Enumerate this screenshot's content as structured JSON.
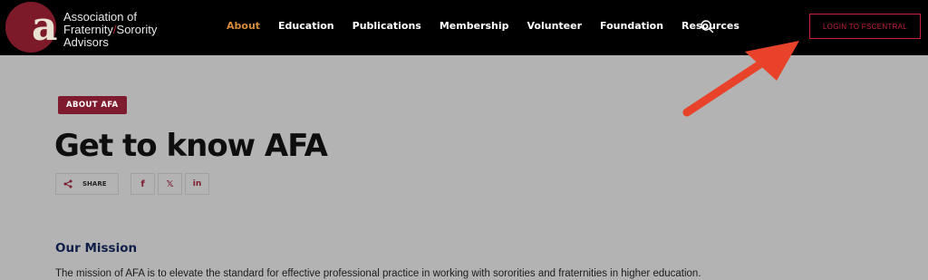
{
  "header": {
    "logo": {
      "letter": "a",
      "text_line1": "Association of",
      "text_line2a": "Fraternity",
      "text_slash": "/",
      "text_line2b": "Sorority",
      "text_line3": "Advisors"
    },
    "nav": [
      {
        "label": "About",
        "active": true
      },
      {
        "label": "Education",
        "active": false
      },
      {
        "label": "Publications",
        "active": false
      },
      {
        "label": "Membership",
        "active": false
      },
      {
        "label": "Volunteer",
        "active": false
      },
      {
        "label": "Foundation",
        "active": false
      },
      {
        "label": "Resources",
        "active": false
      }
    ],
    "search_icon": "search-icon",
    "login_label": "LOGIN TO FSCENTRAL"
  },
  "main": {
    "badge": "ABOUT AFA",
    "title": "Get to know AFA",
    "share_label": "SHARE",
    "social": [
      {
        "icon": "facebook-icon",
        "glyph": "f"
      },
      {
        "icon": "x-icon",
        "glyph": "𝕏"
      },
      {
        "icon": "linkedin-icon",
        "glyph": "in"
      }
    ],
    "mission_title": "Our Mission",
    "mission_text": "The mission of AFA is to elevate the standard for effective professional practice in working with sororities and fraternities in higher education."
  },
  "colors": {
    "brand_red": "#7f1b2e",
    "nav_active": "#d58a3b",
    "login_border": "#c2213f",
    "annotation_arrow": "#e8432a"
  }
}
